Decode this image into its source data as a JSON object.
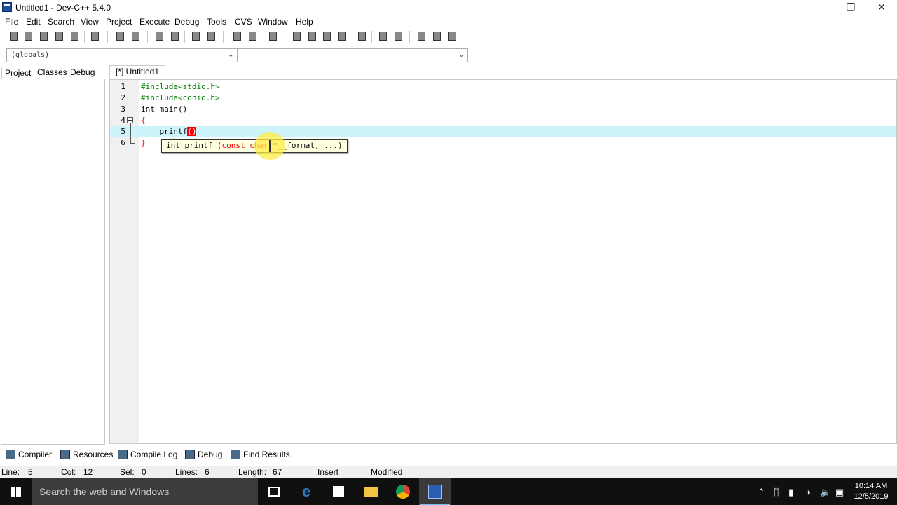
{
  "window": {
    "title": "Untitled1 - Dev-C++ 5.4.0",
    "controls": {
      "minimize": "—",
      "restore": "❐",
      "close": "✕"
    }
  },
  "menu": [
    "File",
    "Edit",
    "Search",
    "View",
    "Project",
    "Execute",
    "Debug",
    "Tools",
    "CVS",
    "Window",
    "Help"
  ],
  "toolbar": {
    "colors": {
      "file": "#f5f5f5",
      "save": "#c8a040",
      "close": "#cc3333",
      "print": "#dddddd",
      "nav": "#9a9a9a",
      "view": "#5b8fd6",
      "check": "#6a3fb5",
      "chart": "#3a70c0",
      "debug": "#b03030"
    }
  },
  "scope": {
    "globals": "(globals)",
    "members": ""
  },
  "left_tabs": [
    "Project",
    "Classes",
    "Debug"
  ],
  "editor": {
    "tab_label": "[*] Untitled1",
    "lines": [
      {
        "num": "1",
        "text": "#include<stdio.h>"
      },
      {
        "num": "2",
        "text": "#include<conio.h>"
      },
      {
        "num": "3",
        "text": "int main()"
      },
      {
        "num": "4",
        "text": "{"
      },
      {
        "num": "5",
        "text": "    printf",
        "highlight": "()"
      },
      {
        "num": "6",
        "text": "}"
      }
    ],
    "tooltip": {
      "before": "int printf ",
      "highlighted": "(const char",
      "after": " *__format, ...)"
    }
  },
  "bottom_tabs": [
    "Compiler",
    "Resources",
    "Compile Log",
    "Debug",
    "Find Results"
  ],
  "status": {
    "line_label": "Line:",
    "line_value": "5",
    "col_label": "Col:",
    "col_value": "12",
    "sel_label": "Sel:",
    "sel_value": "0",
    "lines_label": "Lines:",
    "lines_value": "6",
    "length_label": "Length:",
    "length_value": "67",
    "mode": "Insert",
    "state": "Modified"
  },
  "taskbar": {
    "search_placeholder": "Search the web and Windows",
    "apps": [
      "task-view-icon",
      "edge-icon",
      "store-icon",
      "file-explorer-icon",
      "chrome-icon",
      "devcpp-icon"
    ],
    "time": "10:14 AM",
    "date": "12/5/2019",
    "accent": "#76b9ed"
  }
}
